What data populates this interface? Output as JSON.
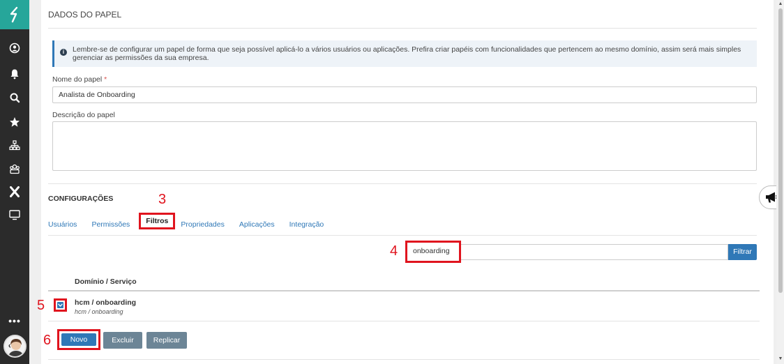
{
  "sidebar": {
    "more_label": "•••"
  },
  "section": {
    "title": "DADOS DO PAPEL",
    "info_text": "Lembre-se de configurar um papel de forma que seja possível aplicá-lo a vários usuários ou aplicações. Prefira criar papéis com funcionalidades que pertencem ao mesmo domínio, assim será mais simples gerenciar as permissões da sua empresa."
  },
  "form": {
    "name_label": "Nome do papel",
    "required_mark": "*",
    "name_value": "Analista de Onboarding",
    "description_label": "Descrição do papel",
    "description_value": ""
  },
  "config": {
    "title": "CONFIGURAÇÕES",
    "tabs": [
      {
        "label": "Usuários"
      },
      {
        "label": "Permissões"
      },
      {
        "label": "Filtros"
      },
      {
        "label": "Propriedades"
      },
      {
        "label": "Aplicações"
      },
      {
        "label": "Integração"
      }
    ],
    "active_tab": "Filtros"
  },
  "filter": {
    "search_value": "onboarding",
    "button_label": "Filtrar"
  },
  "table": {
    "column_header": "Domínio / Serviço",
    "rows": [
      {
        "title": "hcm / onboarding",
        "subtitle": "hcm / onboarding"
      }
    ]
  },
  "actions": {
    "new_label": "Novo",
    "delete_label": "Excluir",
    "replicate_label": "Replicar"
  },
  "annotations": {
    "step3": "3",
    "step4": "4",
    "step5": "5",
    "step6": "6"
  },
  "colors": {
    "accent": "#2f78b7",
    "brand": "#26a69a",
    "annotation": "#e0141e",
    "sidebar": "#2b2b2b"
  },
  "icons": [
    "logo-icon",
    "user-circle-icon",
    "bell-icon",
    "search-icon",
    "star-icon",
    "org-chart-icon",
    "team-icon",
    "x-icon",
    "monitor-icon",
    "info-icon",
    "chevron-down-icon",
    "megaphone-icon"
  ]
}
